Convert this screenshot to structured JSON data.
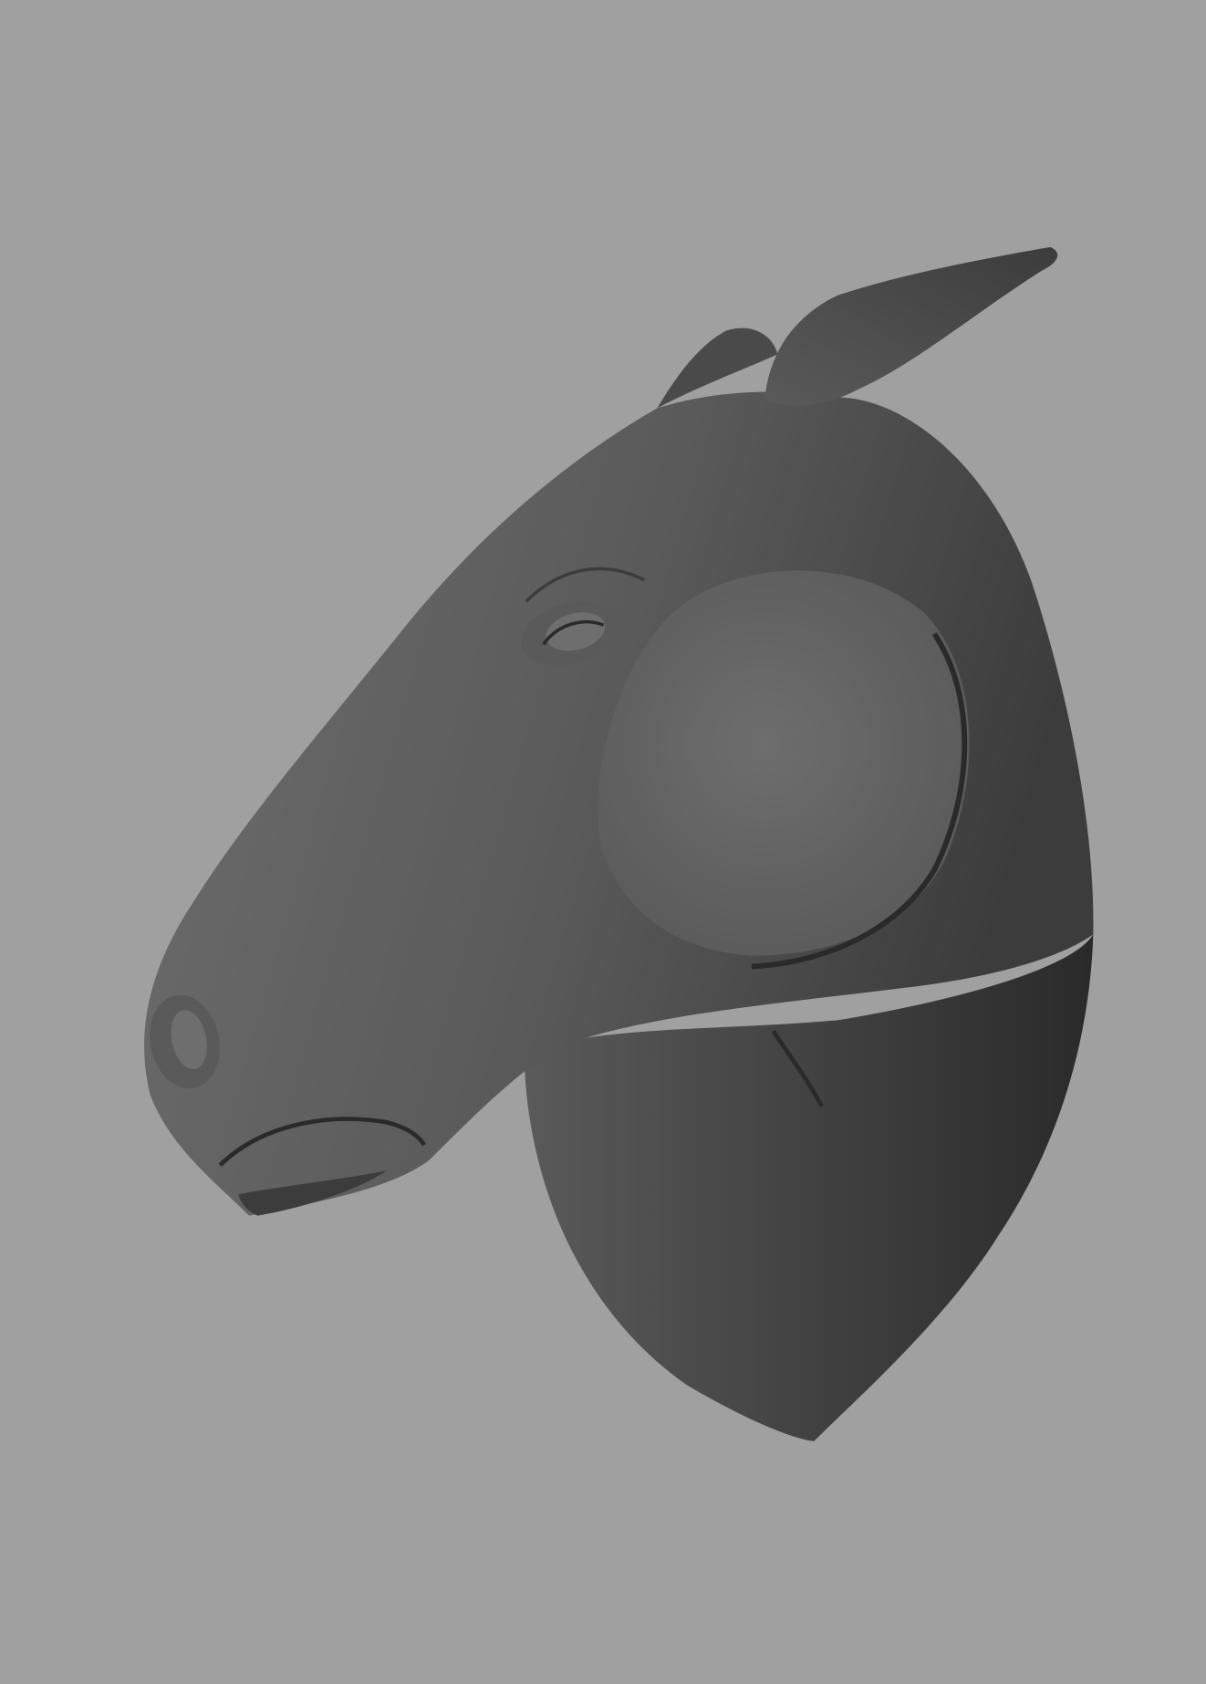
{
  "viewport": {
    "background_color": "#a0a0a0",
    "subject": "horse-head-sculpt",
    "material_colors": {
      "light": "#6e6e6e",
      "mid": "#5a5a5a",
      "dark": "#3c3c3c",
      "deep": "#2a2a2a"
    }
  }
}
